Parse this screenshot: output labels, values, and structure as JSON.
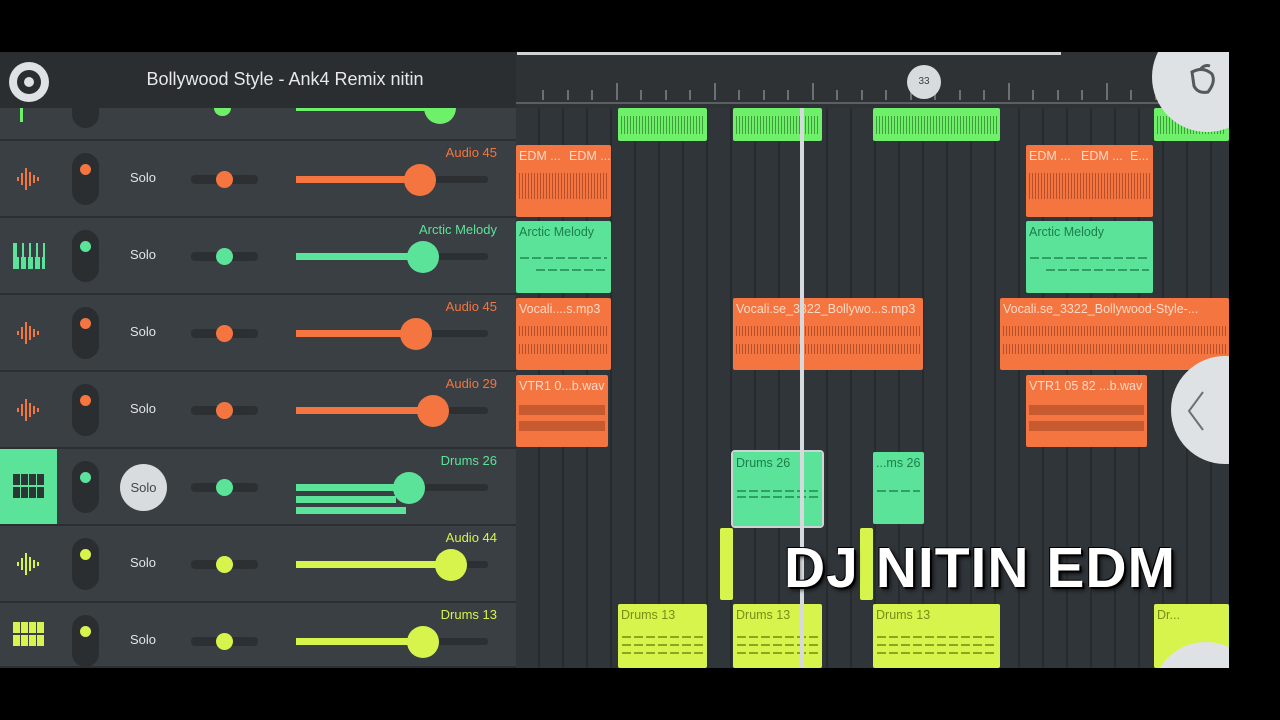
{
  "project_title": "Bollywood Style - Ank4 Remix nitin",
  "marker_number": "33",
  "watermark": "DJ NITIN EDM",
  "colors": {
    "orange": "#f4753f",
    "green": "#5be39a",
    "lime": "#d7f44c",
    "bright_green": "#6ef06a"
  },
  "tracks": [
    {
      "name": "Audio 45",
      "solo": "Solo",
      "icon": "waveform-icon",
      "volume": 0.65
    },
    {
      "name": "Arctic Melody",
      "solo": "Solo",
      "icon": "piano-icon",
      "volume": 0.66
    },
    {
      "name": "Audio 45",
      "solo": "Solo",
      "icon": "waveform-icon",
      "volume": 0.63
    },
    {
      "name": "Audio 29",
      "solo": "Solo",
      "icon": "waveform-icon",
      "volume": 0.71
    },
    {
      "name": "Drums 26",
      "solo": "Solo",
      "icon": "drum-pads-icon",
      "volume": 0.59,
      "selected": true
    },
    {
      "name": "Audio 44",
      "solo": "Solo",
      "icon": "waveform-icon",
      "volume": 0.8
    },
    {
      "name": "Drums 13",
      "solo": "Solo",
      "icon": "drum-pads-icon",
      "volume": 0.66
    }
  ],
  "clips": {
    "audio45a": [
      "EDM ...",
      "EDM ...",
      "EDM ...",
      "EDM ...",
      "E..."
    ],
    "arctic": [
      "Arctic Melody",
      "Arctic Melody"
    ],
    "audio45b": [
      "Vocali....s.mp3",
      "Vocali.se_3322_Bollywo...s.mp3",
      "Vocali.se_3322_Bollywood-Style-..."
    ],
    "audio29": [
      "VTR1 0...b.wav",
      "VTR1 05 82 ...b.wav"
    ],
    "drums26": [
      "Drums 26",
      "...ms 26"
    ],
    "drums13": [
      "Drums 13",
      "Drums 13",
      "Drums 13",
      "Dr..."
    ]
  }
}
